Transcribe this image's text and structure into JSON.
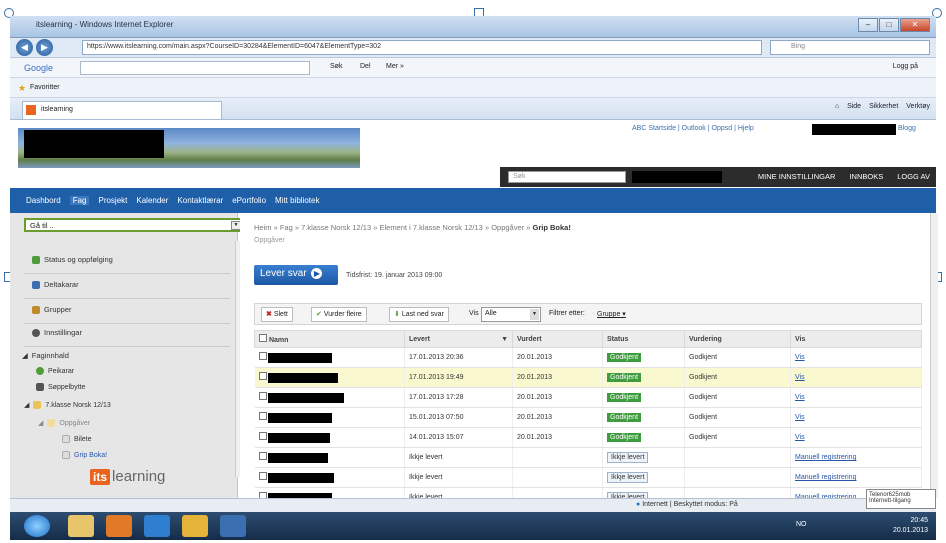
{
  "browser": {
    "title": "itslearning - Windows Internet Explorer",
    "url": "https://www.itslearning.com/main.aspx?CourseID=30284&ElementID=6047&ElementType=302",
    "search_placeholder": "Bing",
    "google_label": "Google",
    "google_search": "Søk",
    "google_share": "Del",
    "google_more": "Mer »",
    "google_login": "Logg på",
    "favorites_label": "Favoritter",
    "tab_label": "itslearning",
    "cmd_items": [
      "Side",
      "Sikkerhet",
      "Verktøy"
    ]
  },
  "site": {
    "top_links": "ABC Startside | Outlook | Oppsd | Hjelp",
    "top_link_suffix": "Blogg",
    "search_placeholder": "Søk",
    "user_links": [
      "MINE INNSTILLINGAR",
      "INNBOKS",
      "LOGG AV"
    ],
    "nav": [
      "Dashbord",
      "Fag",
      "Prosjekt",
      "Kalender",
      "Kontaktlærar",
      "ePortfolio",
      "Mitt bibliotek"
    ],
    "nav_active": "Fag"
  },
  "sidebar": {
    "goto": "Gå til ..",
    "items": [
      "Status og oppfølging",
      "Deltakarar",
      "Grupper",
      "Innstillingar"
    ],
    "tree_header": "Faginnhald",
    "tree": [
      "Peikarar",
      "Søppelbytte",
      "7.klasse Norsk 12/13",
      "Oppgåver",
      "Bilete",
      "Grip Boka!"
    ],
    "logo_box": "its",
    "logo_word": "learning"
  },
  "content": {
    "breadcrumb": "Heim » Fag » 7.klasse Norsk 12/13 » Element i 7.klasse Norsk 12/13 » Oppgåver »",
    "breadcrumb_current": "Grip Boka!",
    "section_cut": "Oppgåver",
    "submit_label": "Lever svar",
    "deadline": "Tidsfrist: 19. januar 2013 09:00",
    "toolbar": {
      "delete": "Slett",
      "assess": "Vurder fleire",
      "download": "Last ned svar",
      "show_label": "Vis",
      "show_value": "Alle",
      "filter_label": "Filtrer etter:",
      "filter_value": "Gruppe"
    },
    "columns": [
      "Namn",
      "Levert",
      "Vurdert",
      "Status",
      "Vurdering",
      "Vis"
    ],
    "rows": [
      {
        "levert": "17.01.2013 20:36",
        "vurdert": "20.01.2013",
        "status": "Godkjent",
        "vurdering": "Godkjent",
        "vis": "Vis",
        "hl": false
      },
      {
        "levert": "17.01.2013 19:49",
        "vurdert": "20.01.2013",
        "status": "Godkjent",
        "vurdering": "Godkjent",
        "vis": "Vis",
        "hl": true
      },
      {
        "levert": "17.01.2013 17:28",
        "vurdert": "20.01.2013",
        "status": "Godkjent",
        "vurdering": "Godkjent",
        "vis": "Vis",
        "hl": false
      },
      {
        "levert": "15.01.2013 07:50",
        "vurdert": "20.01.2013",
        "status": "Godkjent",
        "vurdering": "Godkjent",
        "vis": "Vis",
        "hl": false
      },
      {
        "levert": "14.01.2013 15:07",
        "vurdert": "20.01.2013",
        "status": "Godkjent",
        "vurdering": "Godkjent",
        "vis": "Vis",
        "hl": false
      },
      {
        "levert": "Ikkje levert",
        "vurdert": "",
        "status": "Ikkje levert",
        "vurdering": "",
        "vis": "Manuell registrering",
        "hl": false
      },
      {
        "levert": "Ikkje levert",
        "vurdert": "",
        "status": "Ikkje levert",
        "vurdering": "",
        "vis": "Manuell registrering",
        "hl": false
      },
      {
        "levert": "Ikkje levert",
        "vurdert": "",
        "status": "Ikkje levert",
        "vurdering": "",
        "vis": "Manuell registrering",
        "hl": false
      }
    ]
  },
  "status": {
    "zone": "Internett | Beskyttet modus: På",
    "tooltip": "Telenor625mob Internett-tilgang"
  },
  "taskbar": {
    "lang": "NO",
    "time": "20:45",
    "date": "20.01.2013"
  },
  "colors": {
    "nav_blue": "#1f5fa8",
    "approved_green": "#3e9c3e",
    "highlight_row": "#f9f8cf"
  }
}
